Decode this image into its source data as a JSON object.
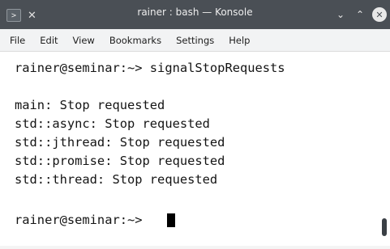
{
  "window": {
    "title": "rainer : bash — Konsole"
  },
  "titlebar": {
    "left_icons": [
      "terminal-icon",
      "pin-icon"
    ],
    "right_buttons": [
      "minimize",
      "maximize",
      "close"
    ]
  },
  "menubar": {
    "items": [
      {
        "label": "File"
      },
      {
        "label": "Edit"
      },
      {
        "label": "View"
      },
      {
        "label": "Bookmarks"
      },
      {
        "label": "Settings"
      },
      {
        "label": "Help"
      }
    ]
  },
  "terminal": {
    "lines": [
      "rainer@seminar:~> signalStopRequests",
      "",
      "main: Stop requested",
      "std::async: Stop requested",
      "std::jthread: Stop requested",
      "std::promise: Stop requested",
      "std::thread: Stop requested",
      "",
      "rainer@seminar:~> "
    ],
    "prompt": "rainer@seminar:~> "
  },
  "colors": {
    "titlebar_bg": "#4a4f55",
    "menubar_bg": "#f2f3f4",
    "terminal_bg": "#ffffff",
    "terminal_fg": "#141414"
  }
}
